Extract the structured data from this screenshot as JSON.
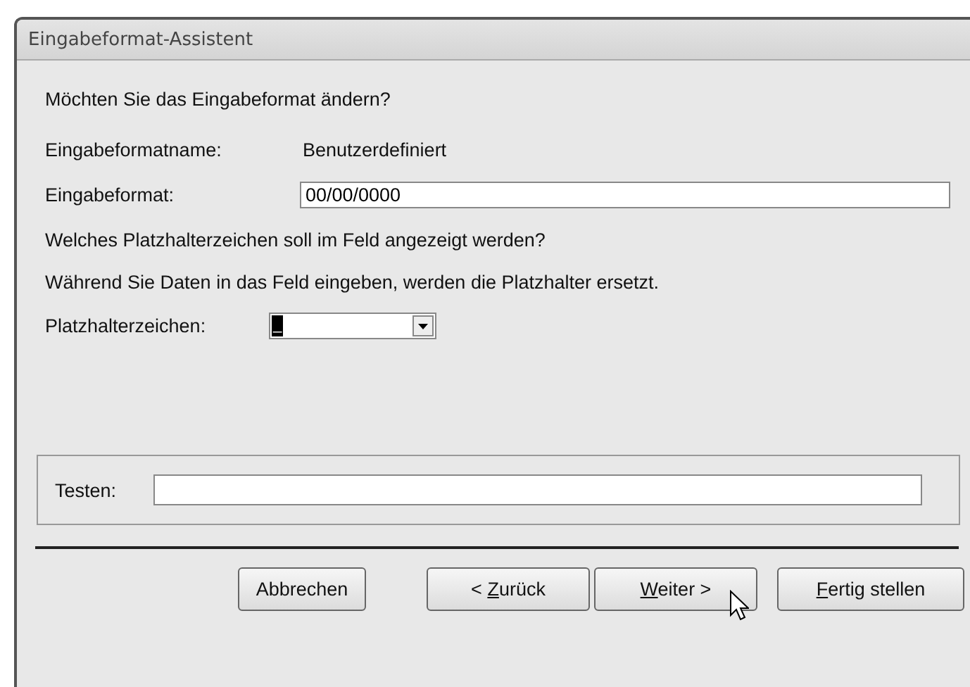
{
  "window": {
    "title": "Eingabeformat-Assistent"
  },
  "question": "Möchten Sie das Eingabeformat ändern?",
  "fields": [
    {
      "label": "Eingabeformatname:",
      "kind": "text",
      "value": "Benutzerdefiniert"
    },
    {
      "label": "Eingabeformat:",
      "kind": "input",
      "value": "00/00/0000"
    }
  ],
  "instructions": [
    "Welches Platzhalterzeichen soll im Feld angezeigt werden?",
    "Während Sie Daten in das Feld eingeben, werden die Platzhalter ersetzt."
  ],
  "placeholder_select": {
    "label": "Platzhalterzeichen:",
    "value": "_"
  },
  "test": {
    "label": "Testen:"
  },
  "buttons": [
    {
      "after": "Abbrechen"
    },
    {
      "before": "< ",
      "key": "Z",
      "after": "urück"
    },
    {
      "key": "W",
      "after": "eiter >"
    },
    {
      "key": "F",
      "after": "ertig stellen"
    }
  ]
}
